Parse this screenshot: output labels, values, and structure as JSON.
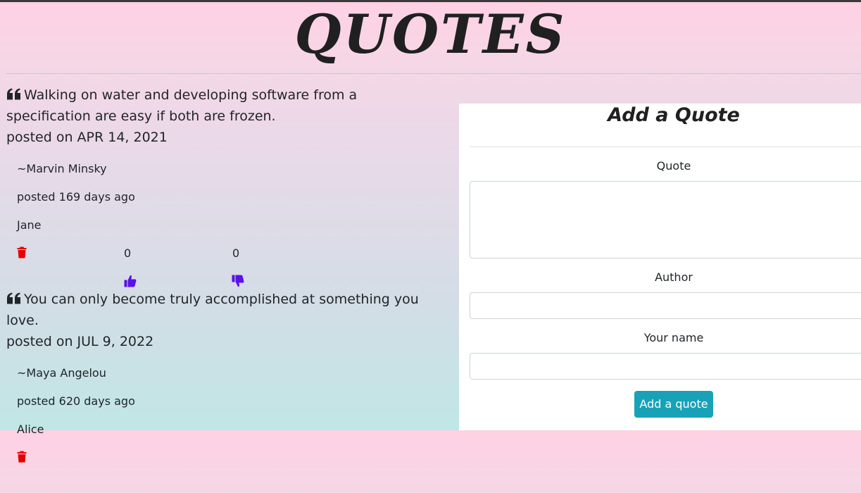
{
  "app": {
    "title": "QUOTES"
  },
  "quotes": [
    {
      "text": "Walking on water and developing software from a specification are easy if both are frozen.",
      "date": "posted on APR 14, 2021",
      "author": "~Marvin Minsky",
      "age": "posted 169 days ago",
      "submitter": "Jane",
      "upvotes": "0",
      "downvotes": "0"
    },
    {
      "text": "You can only become truly accomplished at something you love.",
      "date": "posted on JUL 9, 2022",
      "author": "~Maya Angelou",
      "age": "posted 620 days ago",
      "submitter": "Alice"
    }
  ],
  "form": {
    "title": "Add a Quote",
    "quote_label": "Quote",
    "quote_value": "",
    "author_label": "Author",
    "author_value": "",
    "name_label": "Your name",
    "name_value": "",
    "submit_label": "Add a quote"
  },
  "icons": {
    "quote": "quote-left-icon",
    "delete": "trash-icon",
    "upvote": "thumbs-up-icon",
    "downvote": "thumbs-down-icon"
  },
  "colors": {
    "delete": "#e60000",
    "vote": "#5b11e8",
    "submit": "#17a2b8"
  }
}
